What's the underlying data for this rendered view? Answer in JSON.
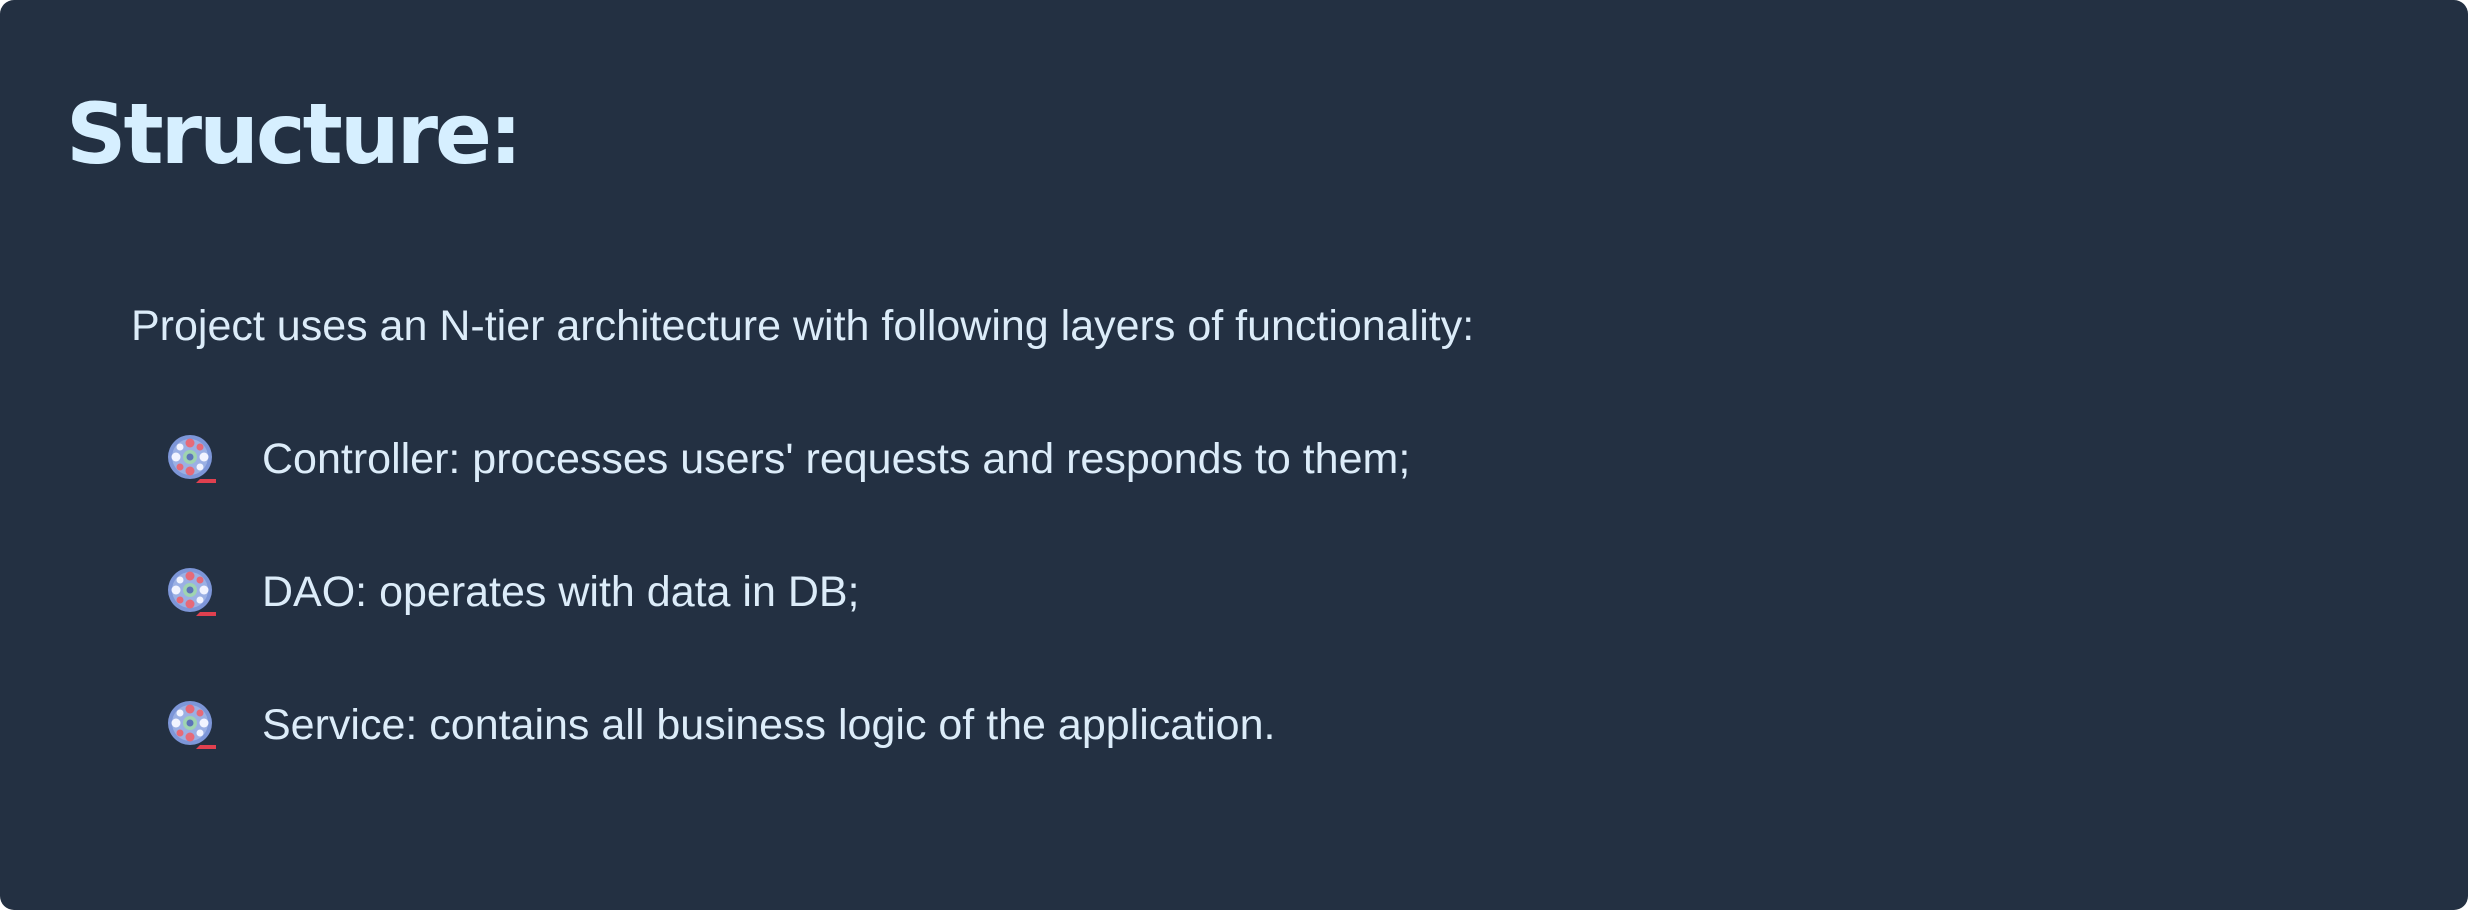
{
  "slide": {
    "title": "Structure:",
    "intro": "Project uses an N-tier architecture with following layers of functionality:",
    "items": [
      {
        "text": "Controller: processes users' requests and responds to them;",
        "icon": "film-reel-icon"
      },
      {
        "text": "DAO: operates with data in DB;",
        "icon": "film-reel-icon"
      },
      {
        "text": "Service: contains all business logic of the application.",
        "icon": "film-reel-icon"
      }
    ]
  },
  "colors": {
    "background": "#233042",
    "title": "#d6efff",
    "text": "#dcecf9"
  }
}
